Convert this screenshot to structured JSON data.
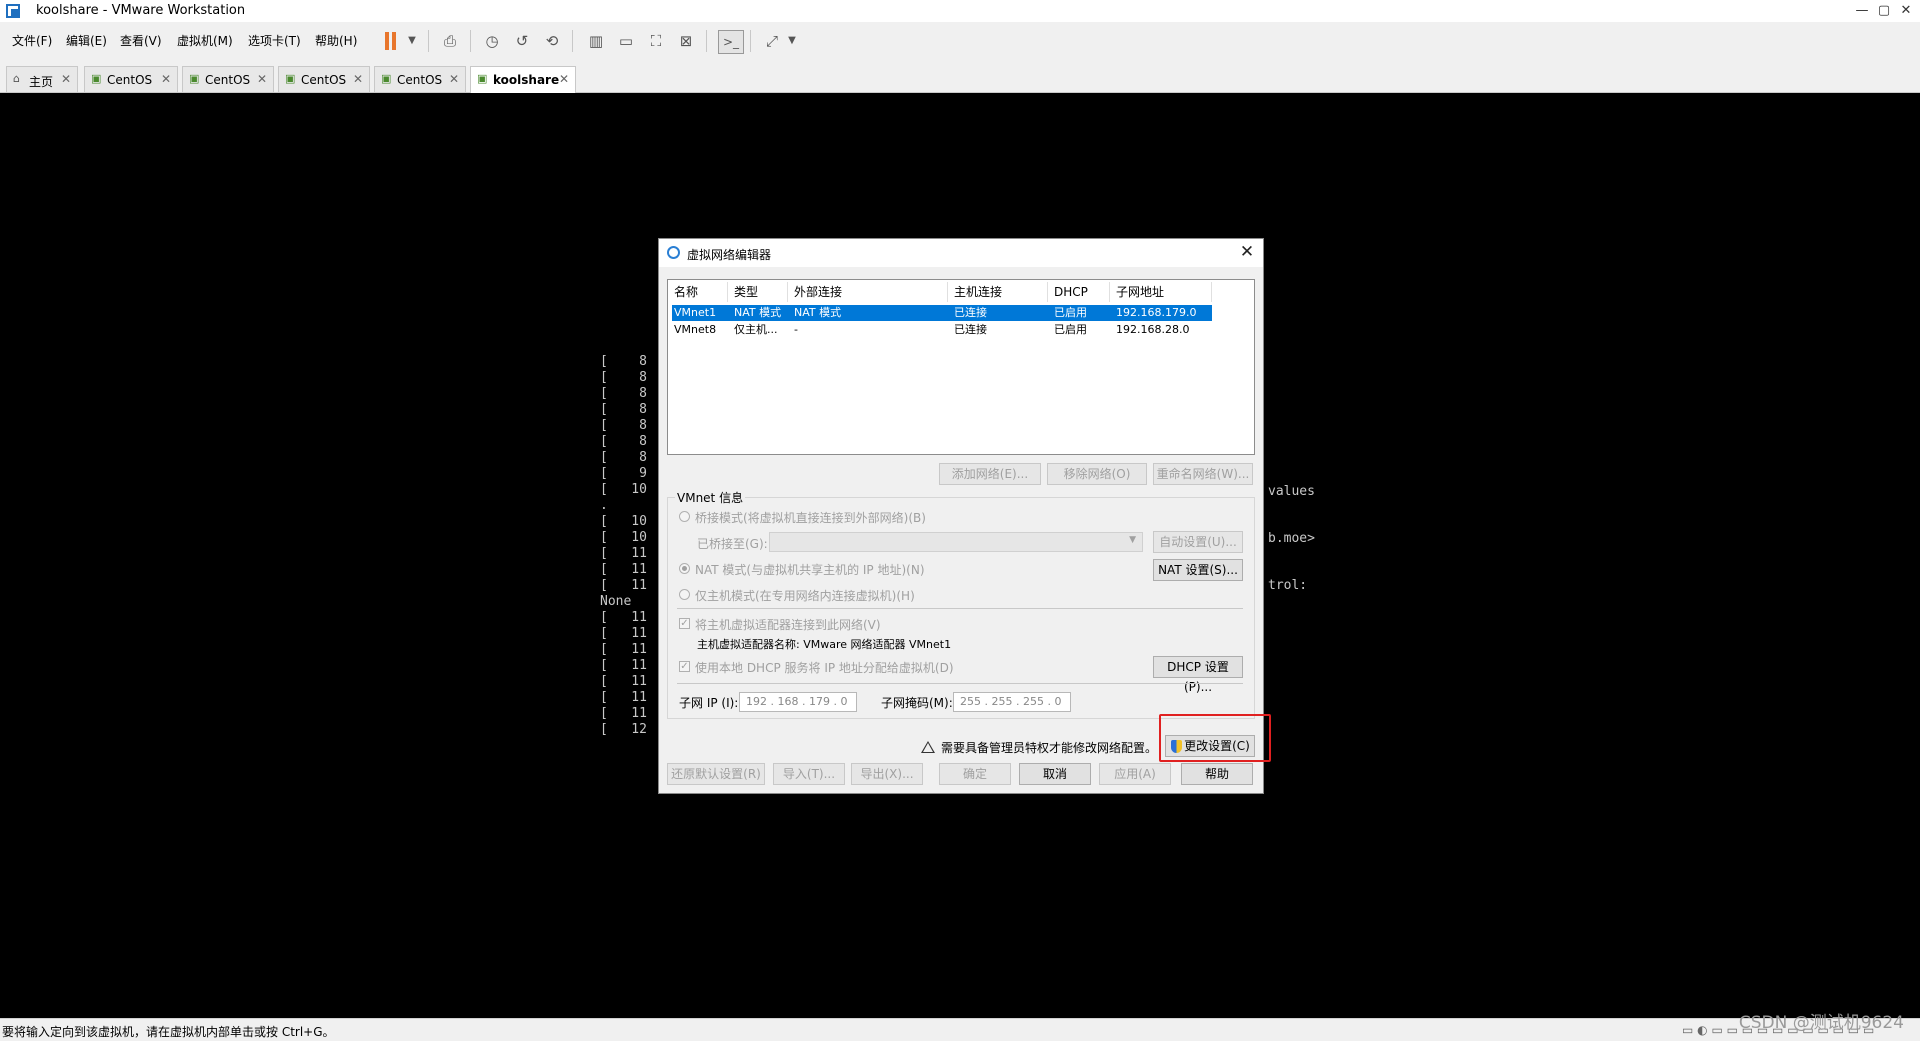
{
  "window": {
    "title": "koolshare - VMware Workstation",
    "minimize": "—",
    "maximize": "▢",
    "close": "✕"
  },
  "menu": {
    "items": [
      "文件(F)",
      "编辑(E)",
      "查看(V)",
      "虚拟机(M)",
      "选项卡(T)",
      "帮助(H)"
    ]
  },
  "tabs": [
    {
      "label": "主页",
      "icon": "home-icon"
    },
    {
      "label": "CentOS",
      "icon": "vm-icon"
    },
    {
      "label": "CentOS",
      "icon": "vm-icon"
    },
    {
      "label": "CentOS",
      "icon": "vm-icon"
    },
    {
      "label": "CentOS",
      "icon": "vm-icon"
    },
    {
      "label": "koolshare",
      "icon": "vm-icon",
      "active": true
    }
  ],
  "console": {
    "left_lines": [
      "[    8",
      "[    8",
      "[    8",
      "[    8",
      "[    8",
      "[    8",
      "[    8",
      "[    9",
      "[   10",
      ".",
      "[   10",
      "[   10",
      "[   11",
      "[   11",
      "[   11",
      "None",
      "[   11",
      "[   11",
      "[   11",
      "[   11",
      "[   11",
      "[   11",
      "[   11",
      "[   12"
    ],
    "right_fragments": [
      "values",
      "b.moe>",
      "trol:"
    ]
  },
  "dialog": {
    "title": "虚拟网络编辑器",
    "columns": [
      "名称",
      "类型",
      "外部连接",
      "主机连接",
      "DHCP",
      "子网地址"
    ],
    "rows": [
      {
        "name": "VMnet1",
        "type": "NAT 模式",
        "external": "NAT 模式",
        "host": "已连接",
        "dhcp": "已启用",
        "subnet": "192.168.179.0",
        "selected": true
      },
      {
        "name": "VMnet8",
        "type": "仅主机...",
        "external": "-",
        "host": "已连接",
        "dhcp": "已启用",
        "subnet": "192.168.28.0",
        "selected": false
      }
    ],
    "list_buttons": {
      "add": "添加网络(E)...",
      "remove": "移除网络(O)",
      "rename": "重命名网络(W)..."
    },
    "vmnet_info": {
      "label": "VMnet 信息",
      "bridged": "桥接模式(将虚拟机直接连接到外部网络)(B)",
      "bridged_to": "已桥接至(G):",
      "auto_settings": "自动设置(U)...",
      "nat": "NAT 模式(与虚拟机共享主机的 IP 地址)(N)",
      "nat_settings": "NAT 设置(S)...",
      "host_only": "仅主机模式(在专用网络内连接虚拟机)(H)",
      "connect_adapter": "将主机虚拟适配器连接到此网络(V)",
      "adapter_name": "主机虚拟适配器名称: VMware 网络适配器 VMnet1",
      "use_dhcp": "使用本地 DHCP 服务将 IP 地址分配给虚拟机(D)",
      "dhcp_settings": "DHCP 设置(P)...",
      "subnet_ip_label": "子网 IP (I):",
      "subnet_ip": "192 . 168 . 179 .  0",
      "subnet_mask_label": "子网掩码(M):",
      "subnet_mask": "255 . 255 . 255 .  0"
    },
    "admin_notice": "需要具备管理员特权才能修改网络配置。",
    "change_settings": "更改设置(C)",
    "bottom_buttons": {
      "restore": "还原默认设置(R)",
      "import": "导入(T)...",
      "export": "导出(X)...",
      "ok": "确定",
      "cancel": "取消",
      "apply": "应用(A)",
      "help": "帮助"
    }
  },
  "status_bar": {
    "text": "要将输入定向到该虚拟机，请在虚拟机内部单击或按 Ctrl+G。"
  },
  "watermark": "CSDN @测试机9624"
}
